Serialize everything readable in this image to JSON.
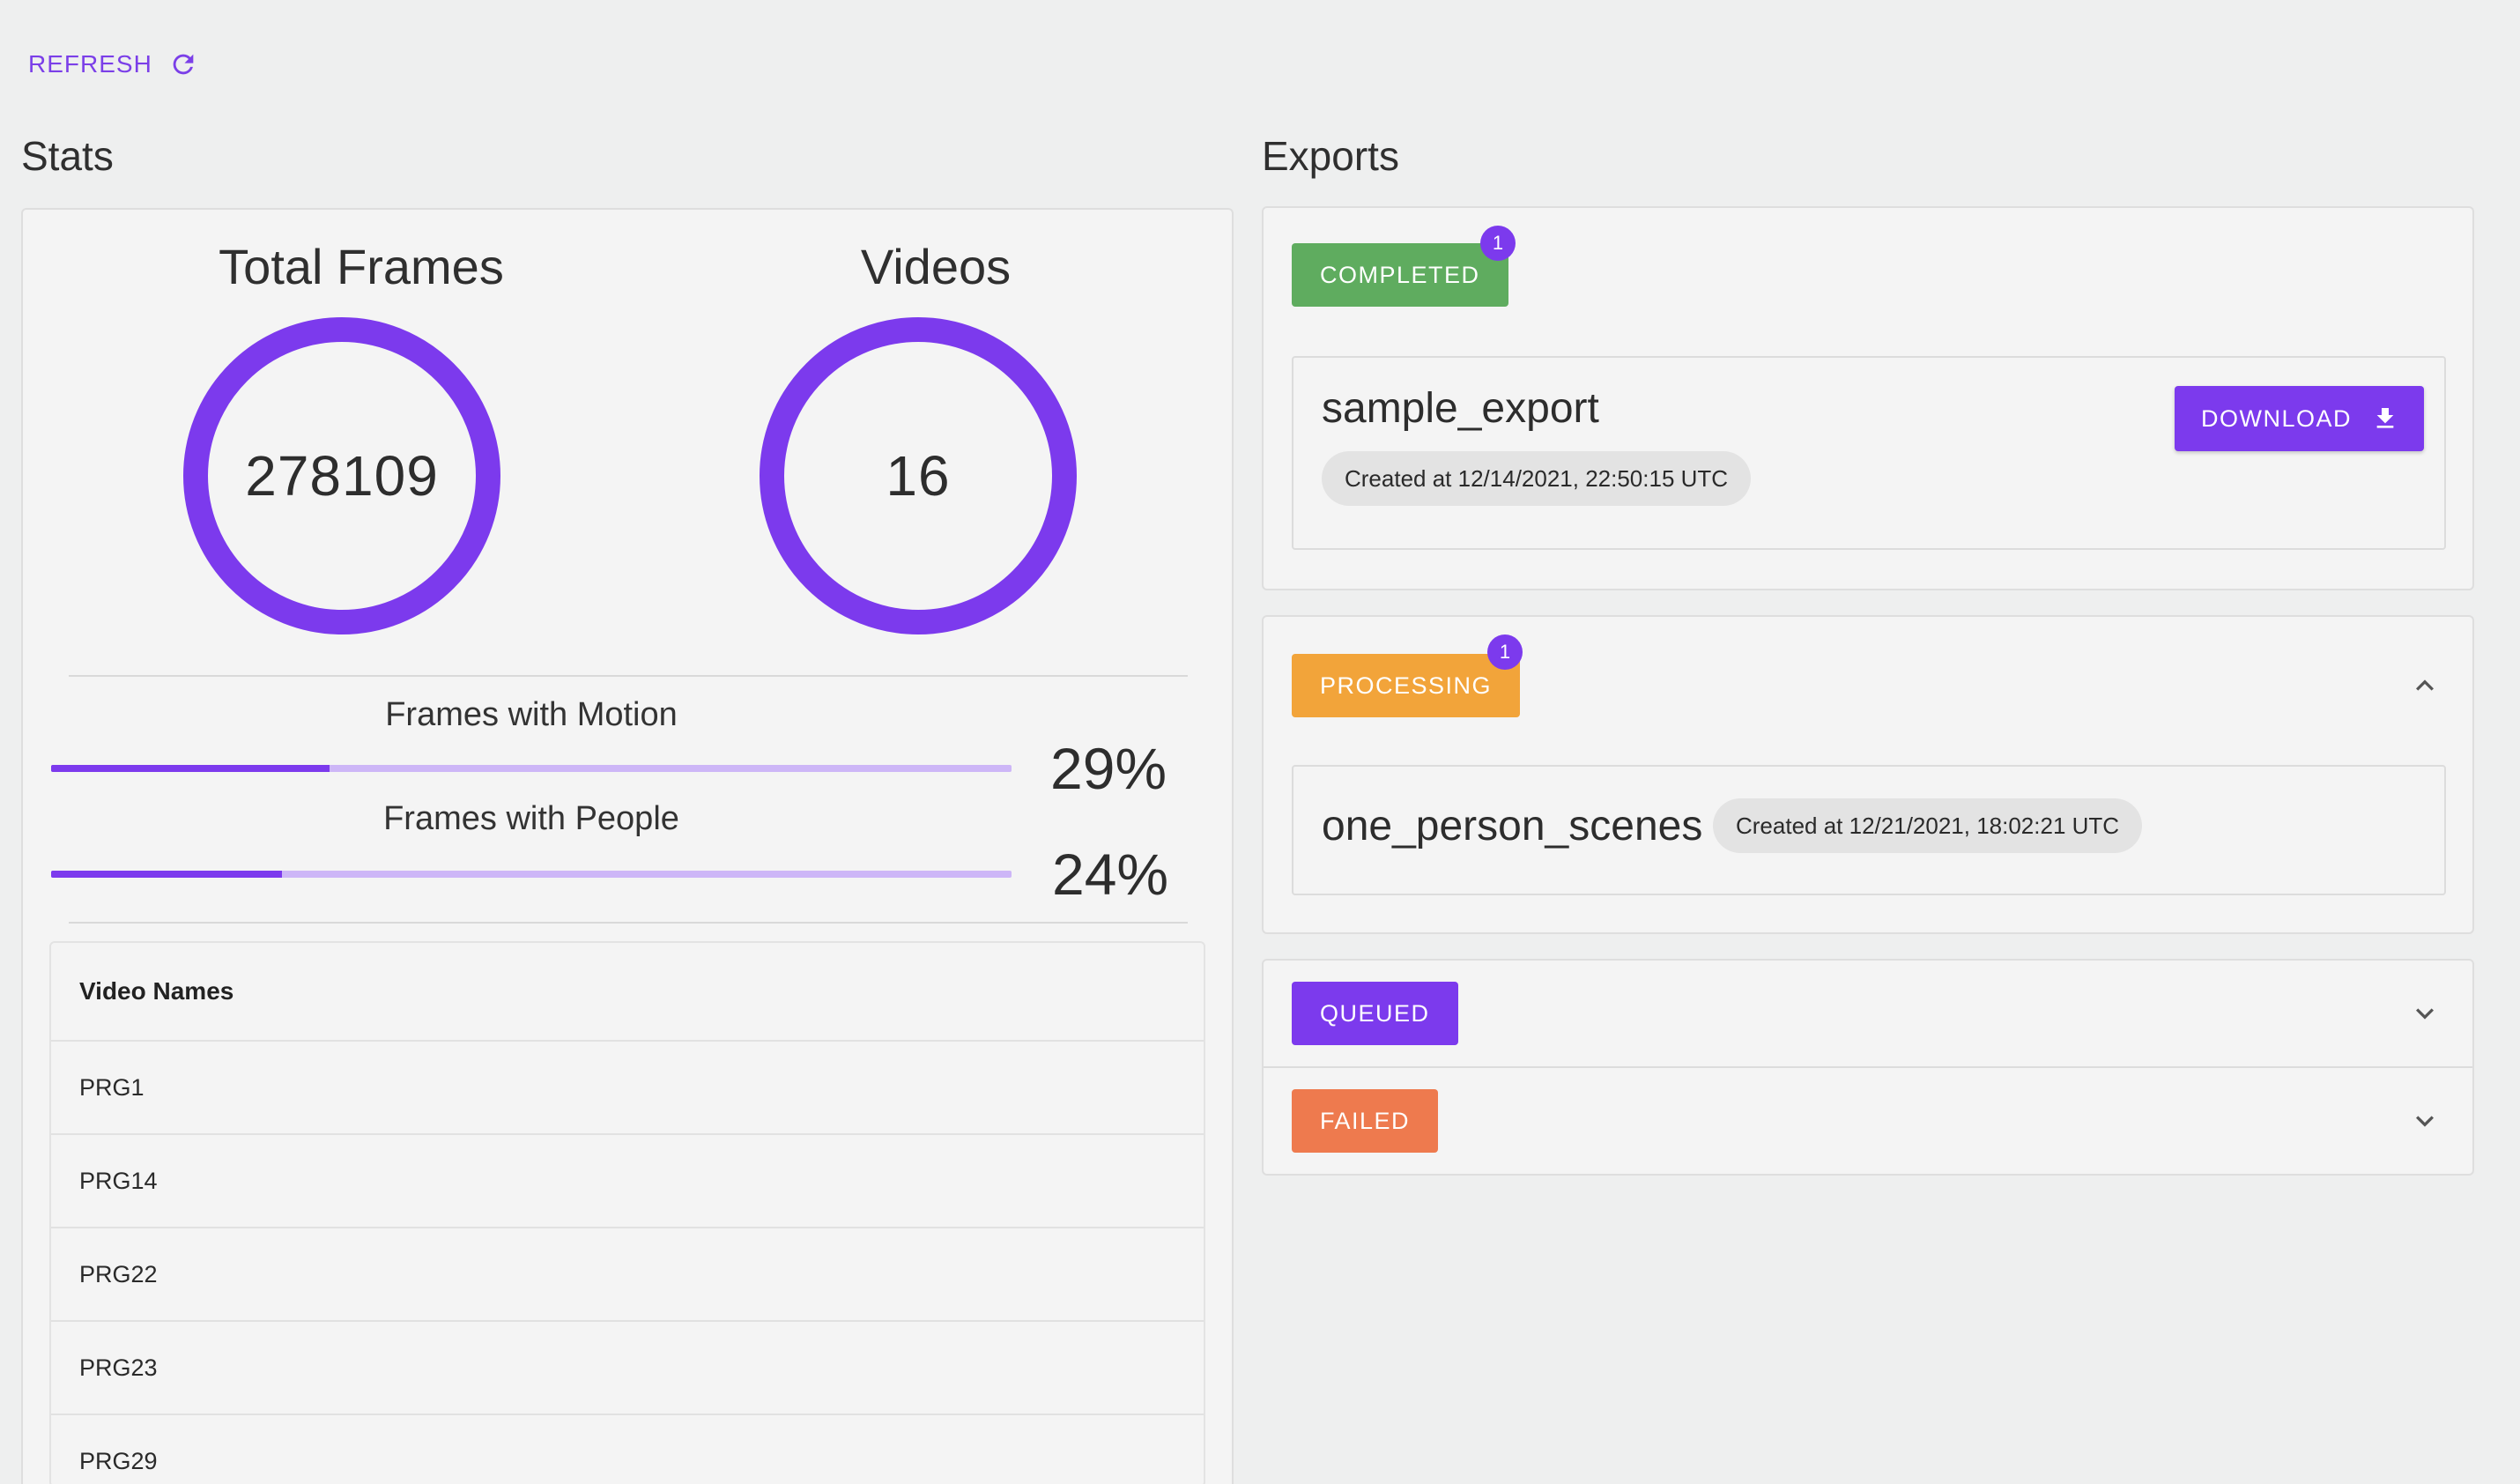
{
  "header": {
    "refresh_label": "REFRESH"
  },
  "stats": {
    "title": "Stats",
    "total_frames": {
      "label": "Total Frames",
      "value": "278109"
    },
    "videos": {
      "label": "Videos",
      "value": "16"
    },
    "motion": {
      "label": "Frames with Motion",
      "percent_text": "29%",
      "percent": 29
    },
    "people": {
      "label": "Frames with People",
      "percent_text": "24%",
      "percent": 24
    },
    "table": {
      "header": "Video Names",
      "rows": [
        "PRG1",
        "PRG14",
        "PRG22",
        "PRG23",
        "PRG29"
      ]
    }
  },
  "exports": {
    "title": "Exports",
    "completed": {
      "label": "COMPLETED",
      "count": "1",
      "item": {
        "name": "sample_export",
        "created": "Created at 12/14/2021, 22:50:15 UTC",
        "download_label": "DOWNLOAD"
      }
    },
    "processing": {
      "label": "PROCESSING",
      "count": "1",
      "item": {
        "name": "one_person_scenes",
        "created": "Created at 12/21/2021, 18:02:21 UTC"
      }
    },
    "queued": {
      "label": "QUEUED"
    },
    "failed": {
      "label": "FAILED"
    }
  },
  "colors": {
    "accent": "#7c3aed",
    "completed": "#5fac5f",
    "processing": "#f2a43a",
    "queued": "#7c3aed",
    "failed": "#ee7a4e"
  },
  "icons": {
    "refresh": "refresh-icon",
    "download": "download-icon",
    "expand": "chevron-down-icon",
    "collapse": "chevron-up-icon"
  }
}
